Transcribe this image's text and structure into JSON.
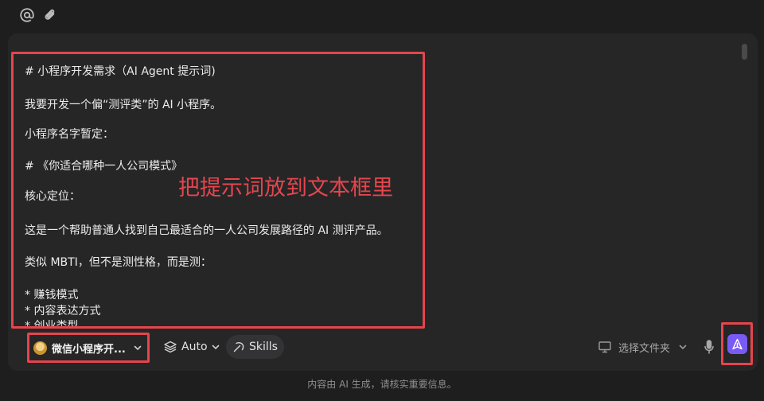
{
  "topbar": {
    "mention_icon": "at-icon",
    "attach_icon": "paperclip-icon"
  },
  "prompt": {
    "lines": [
      "# 小程序开发需求（AI Agent 提示词)",
      "我要开发一个偏“测评类”的 AI 小程序。",
      "小程序名字暂定：",
      "# 《你适合哪种一人公司模式》",
      "核心定位：",
      "这是一个帮助普通人找到自己最适合的一人公司发展路径的 AI 测评产品。",
      "类似 MBTI，但不是测性格，而是测：",
      "* 赚钱模式",
      "* 内容表达方式",
      "* 创业类型"
    ]
  },
  "annotation": "把提示词放到文本框里",
  "toolbar": {
    "workspace_label": "微信小程序开...",
    "mode_label": "Auto",
    "skills_label": "Skills",
    "folder_label": "选择文件夹"
  },
  "footer": {
    "disclaimer": "内容由 AI 生成，请核实重要信息。"
  },
  "colors": {
    "accent": "#7a5af5",
    "highlight": "#e5454d",
    "background": "#1e1e1f",
    "panel": "#262627"
  }
}
